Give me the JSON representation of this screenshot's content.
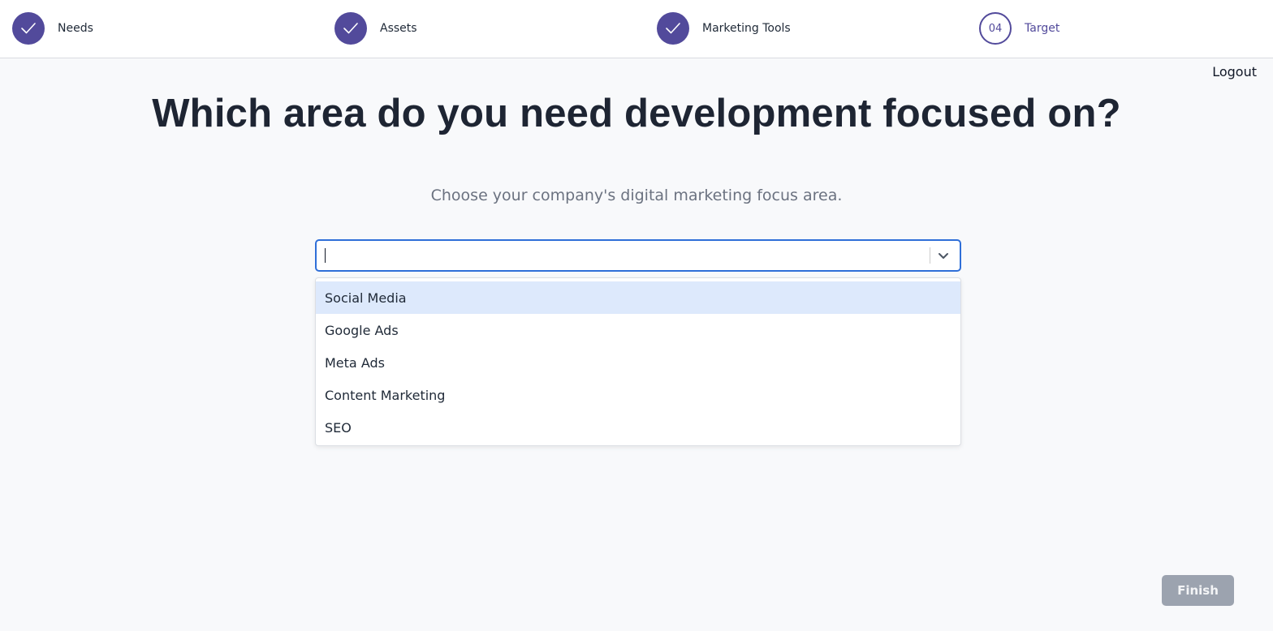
{
  "stepper": {
    "steps": [
      {
        "label": "Needs",
        "state": "done"
      },
      {
        "label": "Assets",
        "state": "done"
      },
      {
        "label": "Marketing Tools",
        "state": "done"
      },
      {
        "label": "Target",
        "number": "04",
        "state": "current"
      }
    ]
  },
  "header": {
    "logout_label": "Logout"
  },
  "main": {
    "title": "Which area do you need development focused on?",
    "subtitle": "Choose your company's digital marketing focus area.",
    "select": {
      "value": "",
      "options": [
        "Social Media",
        "Google Ads",
        "Meta Ads",
        "Content Marketing",
        "SEO"
      ],
      "highlighted": "Social Media"
    }
  },
  "footer": {
    "finish_label": "Finish"
  },
  "colors": {
    "accent": "#524a9b",
    "focus_border": "#2f6fd8",
    "highlight": "#dde9fc",
    "disabled_button": "#9ca3af"
  },
  "icons": {
    "done_step": "check-icon",
    "select_toggle": "chevron-down-icon"
  }
}
